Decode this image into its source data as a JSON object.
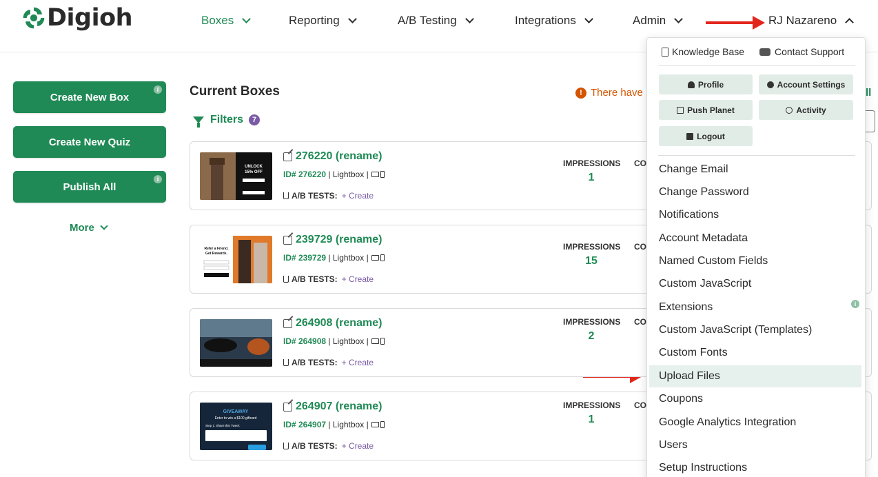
{
  "app": {
    "logo_text": "Digioh",
    "brand_color": "#1f8a55",
    "accent_purple": "#7a5aa6",
    "alert_color": "#d45400",
    "annotation_color": "#e3261c"
  },
  "nav": {
    "items": [
      {
        "label": "Boxes",
        "active": true
      },
      {
        "label": "Reporting",
        "active": false
      },
      {
        "label": "A/B Testing",
        "active": false
      },
      {
        "label": "Integrations",
        "active": false
      },
      {
        "label": "Admin",
        "active": false
      }
    ],
    "user": {
      "label": "RJ Nazareno",
      "expanded": true
    }
  },
  "sidebar": {
    "create_box": "Create New Box",
    "create_quiz": "Create New Quiz",
    "publish_all": "Publish All",
    "info_glyph": "i",
    "more": "More"
  },
  "main": {
    "title": "Current Boxes",
    "filters_label": "Filters",
    "filters_count": "7",
    "alert_icon": "!",
    "alert_text": "There have b",
    "right_stub": "ll",
    "cards": [
      {
        "name": "276220 (rename)",
        "id": "ID# 276220",
        "type": "Lightbox",
        "ab_label": "A/B TESTS:",
        "ab_create": "+ Create",
        "imp_label": "IMPRESSIONS",
        "imp_value": "1",
        "co_label": "CO"
      },
      {
        "name": "239729 (rename)",
        "id": "ID# 239729",
        "type": "Lightbox",
        "ab_label": "A/B TESTS:",
        "ab_create": "+ Create",
        "imp_label": "IMPRESSIONS",
        "imp_value": "15",
        "co_label": "CO"
      },
      {
        "name": "264908 (rename)",
        "id": "ID# 264908",
        "type": "Lightbox",
        "ab_label": "A/B TESTS:",
        "ab_create": "+ Create",
        "imp_label": "IMPRESSIONS",
        "imp_value": "2",
        "co_label": "CO"
      },
      {
        "name": "264907 (rename)",
        "id": "ID# 264907",
        "type": "Lightbox",
        "ab_label": "A/B TESTS:",
        "ab_create": "+ Create",
        "imp_label": "IMPRESSIONS",
        "imp_value": "1",
        "co_label": "CO"
      }
    ],
    "thumb_texts": {
      "unlock": "UNLOCK",
      "off": "15% OFF",
      "refer1": "Refer a Friend.",
      "refer2": "Get Rewards.",
      "giveaway": "GIVEAWAY",
      "giveaway_sub": "Enter to win a $100 giftcard",
      "giveaway_step": "Step 1: Share this Tweet:"
    }
  },
  "dropdown": {
    "knowledge_base": "Knowledge Base",
    "contact_support": "Contact Support",
    "profile": "Profile",
    "account_settings": "Account Settings",
    "push_planet": "Push Planet",
    "activity": "Activity",
    "logout": "Logout",
    "info_glyph": "i",
    "items": [
      "Change Email",
      "Change Password",
      "Notifications",
      "Account Metadata",
      "Named Custom Fields",
      "Custom JavaScript",
      "Extensions",
      "Custom JavaScript (Templates)",
      "Custom Fonts",
      "Upload Files",
      "Coupons",
      "Google Analytics Integration",
      "Users",
      "Setup Instructions"
    ],
    "highlighted_item": "Upload Files"
  }
}
